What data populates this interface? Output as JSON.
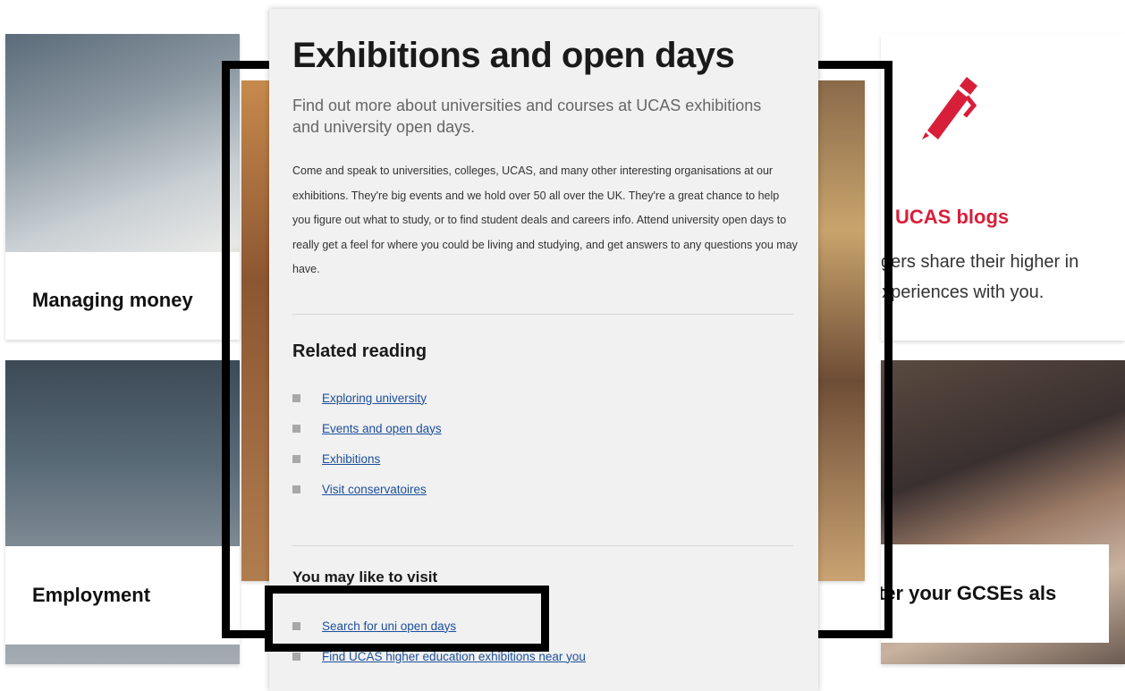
{
  "cards": {
    "money": {
      "label": "Managing money"
    },
    "employment": {
      "label": "Employment"
    },
    "blogs": {
      "title": "UCAS blogs",
      "description": "xgers share their higher in experiences with you."
    },
    "gcse": {
      "label": ":after your GCSEs als"
    }
  },
  "panel": {
    "title": "Exhibitions and open days",
    "subtitle": "Find out more about universities and courses at UCAS exhibitions and university open days.",
    "body": "Come and speak to universities, colleges, UCAS, and many other interesting organisations at our exhibitions. They're big events and we hold over 50 all over the UK. They're a great chance to help you figure out what to study, or to find student deals and careers info. Attend university open days to really get a feel for where you could be living and studying, and get answers to any questions you may have.",
    "related_heading": "Related reading",
    "related_links": [
      "Exploring university",
      "Events and open days",
      "Exhibitions",
      "Visit conservatoires"
    ],
    "visit_heading": "You may like to visit",
    "visit_links": [
      "Search for uni open days",
      "Find UCAS higher education exhibitions near you"
    ]
  },
  "colors": {
    "accent_red": "#d81f3a",
    "link_blue": "#1c4f9c",
    "panel_bg": "#f1f1f1"
  },
  "icons": {
    "blog_icon": "pen-icon",
    "list_bullet": "square-bullet-icon"
  }
}
